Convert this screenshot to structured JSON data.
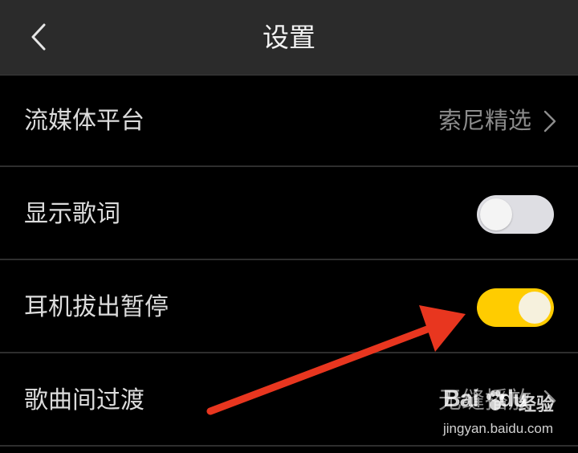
{
  "header": {
    "title": "设置",
    "back_icon": "chevron-left-icon"
  },
  "settings": [
    {
      "label": "流媒体平台",
      "type": "link",
      "value": "索尼精选"
    },
    {
      "label": "显示歌词",
      "type": "toggle",
      "enabled": false
    },
    {
      "label": "耳机拔出暂停",
      "type": "toggle",
      "enabled": true
    },
    {
      "label": "歌曲间过渡",
      "type": "link",
      "value": "无缝播放"
    }
  ],
  "annotation": {
    "type": "arrow",
    "color": "#e8361f",
    "points_to": "耳机拔出暂停 toggle"
  },
  "watermark": {
    "logo": "Bai",
    "logo_suffix": "du",
    "text": "经验",
    "url": "jingyan.baidu.com"
  },
  "colors": {
    "header_bg": "#2b2b2b",
    "background": "#000000",
    "toggle_on": "#ffcc00",
    "toggle_off": "#dedee3"
  }
}
